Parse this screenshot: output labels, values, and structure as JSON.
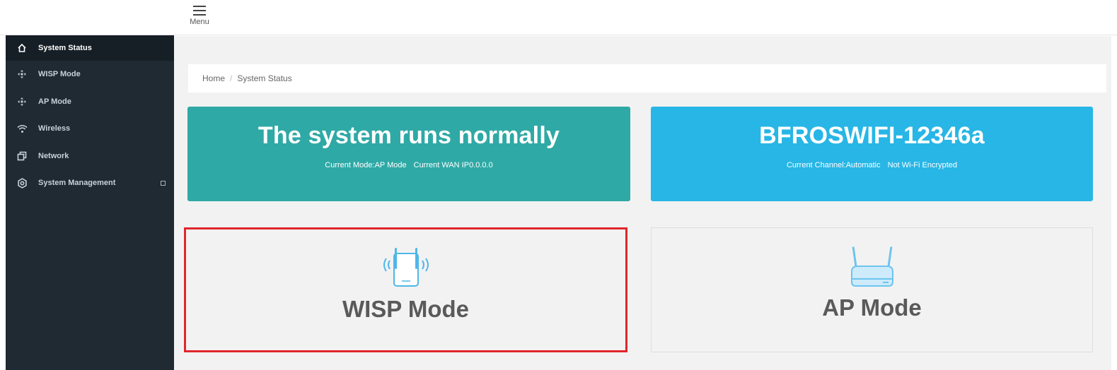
{
  "header": {
    "menu_label": "Menu"
  },
  "sidebar": {
    "items": [
      {
        "label": "System Status",
        "icon": "home-icon"
      },
      {
        "label": "WISP Mode",
        "icon": "move-arrows-icon"
      },
      {
        "label": "AP Mode",
        "icon": "move-arrows-icon"
      },
      {
        "label": "Wireless",
        "icon": "wifi-icon"
      },
      {
        "label": "Network",
        "icon": "windows-icon"
      },
      {
        "label": "System Management",
        "icon": "gear-icon"
      }
    ]
  },
  "breadcrumb": {
    "home": "Home",
    "separator": "/",
    "current": "System Status"
  },
  "status_card": {
    "title": "The system runs normally",
    "mode_text": "Current Mode:AP Mode",
    "wan_text": "Current WAN IP0.0.0.0"
  },
  "wifi_card": {
    "title": "BFROSWIFI-12346a",
    "channel_text": "Current Channel:Automatic",
    "encryption_text": "Not Wi-Fi Encrypted"
  },
  "modes": {
    "wisp": {
      "label": "WISP Mode",
      "icon": "repeater-icon",
      "selected": true
    },
    "ap": {
      "label": "AP Mode",
      "icon": "router-icon",
      "selected": false
    }
  },
  "colors": {
    "sidebar": "#1f2a33",
    "status_card": "#2fa9a6",
    "wifi_card": "#27b6e6",
    "highlight": "#e0262c"
  }
}
